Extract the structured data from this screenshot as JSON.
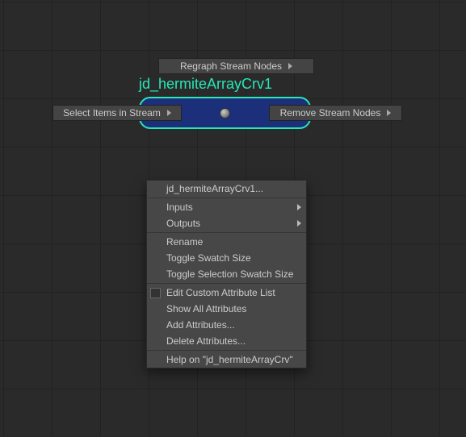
{
  "toolbar": {
    "regraph_label": "Regraph Stream Nodes",
    "select_label": "Select Items in Stream",
    "remove_label": "Remove Stream Nodes"
  },
  "node": {
    "title": "jd_hermiteArrayCrv1"
  },
  "context_menu": {
    "items": [
      {
        "label": "jd_hermiteArrayCrv1...",
        "submenu": false
      },
      {
        "label": "Inputs",
        "submenu": true
      },
      {
        "label": "Outputs",
        "submenu": true
      },
      {
        "label": "Rename",
        "submenu": false
      },
      {
        "label": "Toggle Swatch Size",
        "submenu": false
      },
      {
        "label": "Toggle Selection Swatch Size",
        "submenu": false
      },
      {
        "label": "Edit Custom Attribute List",
        "submenu": false,
        "checkbox": true
      },
      {
        "label": "Show All Attributes",
        "submenu": false
      },
      {
        "label": "Add Attributes...",
        "submenu": false
      },
      {
        "label": "Delete Attributes...",
        "submenu": false
      },
      {
        "label": "Help on \"jd_hermiteArrayCrv\"",
        "submenu": false
      }
    ]
  }
}
